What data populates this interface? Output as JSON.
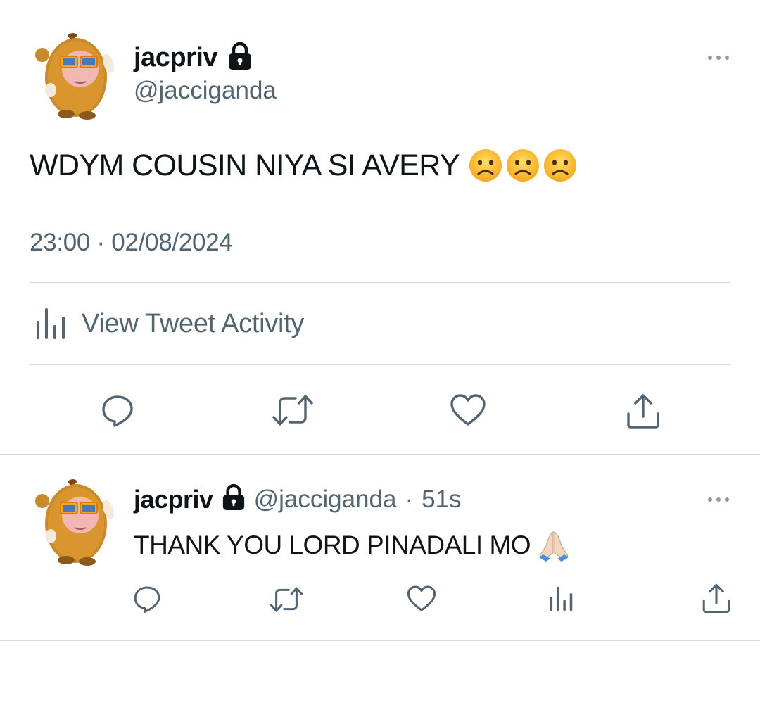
{
  "main_tweet": {
    "display_name": "jacpriv",
    "handle": "@jacciganda",
    "text": "WDYM COUSIN NIYA SI AVERY",
    "emojis": [
      "frowning-face",
      "frowning-face",
      "frowning-face"
    ],
    "timestamp": "23:00 · 02/08/2024",
    "activity_label": "View Tweet Activity",
    "actions": [
      "reply-icon",
      "retweet-icon",
      "like-icon",
      "share-icon"
    ]
  },
  "reply_tweet": {
    "display_name": "jacpriv",
    "handle": "@jacciganda",
    "separator": "·",
    "time_ago": "51s",
    "text": "THANK YOU LORD PINADALI MO",
    "emoji": "folded-hands",
    "actions": [
      "reply-icon",
      "retweet-icon",
      "like-icon",
      "analytics-icon",
      "share-icon"
    ]
  },
  "colors": {
    "text_primary": "#0f1419",
    "text_secondary": "#536471",
    "divider": "#cfd9de",
    "icon": "#536471"
  }
}
